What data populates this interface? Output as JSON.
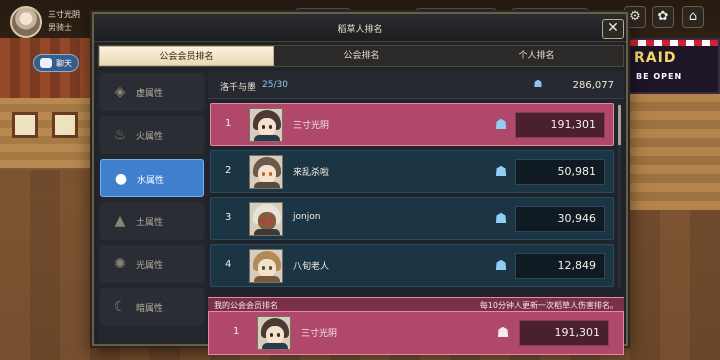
{
  "player": {
    "name": "三寸光阴",
    "class": "男骑士"
  },
  "chat": {
    "label": "聊天"
  },
  "banner": {
    "line1": "RAID",
    "line2": "BE OPEN"
  },
  "modal": {
    "title": "稻草人排名",
    "close_label": "✕",
    "tabs": [
      {
        "label": "公会会员排名",
        "active": true
      },
      {
        "label": "公会排名",
        "active": false
      },
      {
        "label": "个人排名",
        "active": false
      }
    ]
  },
  "sidebar": {
    "items": [
      {
        "label": "虚属性",
        "icon": "diamond-icon",
        "glyph": "◈",
        "active": false
      },
      {
        "label": "火属性",
        "icon": "flame-icon",
        "glyph": "♨",
        "active": false
      },
      {
        "label": "水属性",
        "icon": "water-drop-icon",
        "glyph": "💧",
        "active": true
      },
      {
        "label": "土属性",
        "icon": "mountain-icon",
        "glyph": "⛰",
        "active": false
      },
      {
        "label": "光属性",
        "icon": "sun-icon",
        "glyph": "✺",
        "active": false
      },
      {
        "label": "暗属性",
        "icon": "moon-icon",
        "glyph": "☾",
        "active": false
      }
    ]
  },
  "guild": {
    "name": "洛千与墨",
    "count": "25/30",
    "total_damage": "286,077"
  },
  "ranking": [
    {
      "rank": "1",
      "name": "三寸光阴",
      "damage": "191,301",
      "highlight": true
    },
    {
      "rank": "2",
      "name": "来乱杀啦",
      "damage": "50,981",
      "highlight": false
    },
    {
      "rank": "3",
      "name": "jonjon",
      "damage": "30,946",
      "highlight": false
    },
    {
      "rank": "4",
      "name": "八旬老人",
      "damage": "12,849",
      "highlight": false
    }
  ],
  "my_rank": {
    "title": "我的公会会员排名",
    "note": "每10分钟人更新一次稻草人伤害排名。",
    "rank": "1",
    "name": "三寸光阴",
    "damage": "191,301"
  },
  "colors": {
    "accent_blue": "#3f7fcd",
    "highlight_pink": "#b0486c",
    "row_dark": "#1c3545"
  }
}
